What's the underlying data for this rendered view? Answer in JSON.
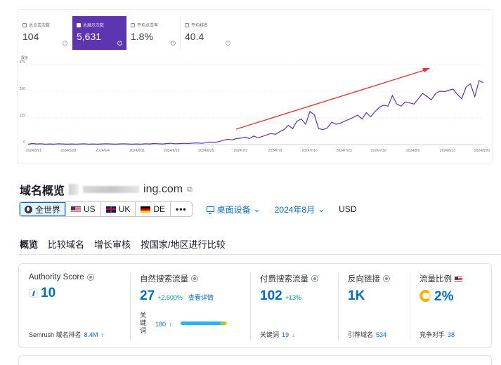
{
  "gsc": {
    "cards": [
      {
        "label": "总点击次数",
        "value": "104",
        "active": false
      },
      {
        "label": "总展示次数",
        "value": "5,631",
        "active": true
      },
      {
        "label": "平均点击率",
        "value": "1.8%",
        "active": false
      },
      {
        "label": "平均排名",
        "value": "40.4",
        "active": false
      }
    ],
    "help_glyph": "?"
  },
  "chart_data": {
    "type": "line",
    "ylabel": "展示",
    "ylim": [
      0,
      375
    ],
    "yticks": [
      0,
      125,
      250,
      375
    ],
    "xticks": [
      "2024/5/21",
      "2024/5/28",
      "2024/6/4",
      "2024/6/11",
      "2024/6/18",
      "2024/6/25",
      "2024/7/2",
      "2024/7/9",
      "2024/7/16",
      "2024/7/23",
      "2024/7/30",
      "2024/8/6",
      "2024/8/13",
      "2024/8/20"
    ],
    "series": [
      {
        "color": "#5e35b1",
        "values": [
          2,
          5,
          3,
          4,
          2,
          3,
          2,
          4,
          3,
          2,
          3,
          2,
          3,
          4,
          2,
          3,
          2,
          3,
          4,
          3,
          2,
          3,
          4,
          3,
          2,
          3,
          2,
          4,
          3,
          5,
          4,
          3,
          5,
          6,
          4,
          5,
          6,
          5,
          7,
          8,
          6,
          9,
          12,
          10,
          14,
          20,
          25,
          22,
          28,
          30,
          35,
          28,
          40,
          32,
          38,
          45,
          52,
          48,
          60,
          70,
          90,
          75,
          110,
          120,
          95,
          155,
          140,
          75,
          70,
          78,
          105,
          95,
          100,
          110,
          118,
          128,
          138,
          120,
          150,
          130,
          155,
          175,
          185,
          180,
          230,
          190,
          180,
          200,
          195,
          190,
          215,
          240,
          225,
          210,
          240,
          250,
          248,
          255,
          260,
          235,
          215,
          270,
          285,
          225,
          300,
          290
        ]
      }
    ],
    "arrow_color": "#e53935"
  },
  "domain": {
    "title_prefix": "域名概览",
    "title_suffix": "ing.com",
    "external_icon": "⧉"
  },
  "filters": {
    "regions": [
      "全世界",
      "US",
      "UK",
      "DE",
      "•••"
    ],
    "device": "桌面设备",
    "date": "2024年8月",
    "currency": "USD"
  },
  "tabs": [
    "概览",
    "比较域名",
    "增长审核",
    "按国家/地区进行比较"
  ],
  "metrics": {
    "authority": {
      "label": "Authority Score",
      "value": "10",
      "foot_label": "Semrush 域名排名",
      "foot_value": "8.4M",
      "foot_trend": "↑"
    },
    "organic": {
      "label": "自然搜索流量",
      "value": "27",
      "change": "+2,600%",
      "link": "查看详情",
      "kw_label": "关键词",
      "kw_value": "180",
      "kw_trend": "↑"
    },
    "paid": {
      "label": "付费搜索流量",
      "value": "102",
      "change": "+13%",
      "foot_label": "关键词",
      "foot_value": "19",
      "foot_trend": "↓"
    },
    "backlinks": {
      "label": "反向链接",
      "value": "1K",
      "foot_label": "引荐域名",
      "foot_value": "534"
    },
    "share": {
      "label": "流量比例",
      "value": "2%",
      "foot_label": "竞争对手",
      "foot_value": "38"
    }
  }
}
